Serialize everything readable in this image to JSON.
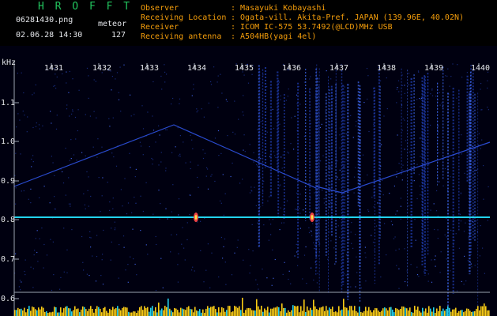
{
  "header": {
    "logo": "H R O F F T",
    "filename": "06281430.png",
    "datetime": "02.06.28 14:30",
    "meteor_label": "meteor",
    "meteor_count": "127",
    "fields": [
      {
        "label": "Observer",
        "value": ": Masayuki Kobayashi"
      },
      {
        "label": "Receiving Location",
        "value": ": Ogata-vill. Akita-Pref. JAPAN (139.96E, 40.02N)"
      },
      {
        "label": "Receiver",
        "value": ": ICOM IC-575 53.7492(@LCD)MHz USB"
      },
      {
        "label": "Receiving antenna",
        "value": ": A504HB(yagi 4el)"
      }
    ]
  },
  "spectrogram": {
    "freq_unit": "kHz",
    "y_ticks": [
      "1.1",
      "1.0",
      "0.9",
      "0.8",
      "0.7",
      "0.6"
    ],
    "x_ticks": [
      "1431",
      "1432",
      "1433",
      "1434",
      "1435",
      "1436",
      "1437",
      "1438",
      "1439",
      "1440"
    ],
    "colors": {
      "background": "#000010",
      "noise": "#1e3aa8",
      "carrier": "#22d3ee",
      "echo": "#ef4444",
      "histogram": "#facc15"
    }
  }
}
